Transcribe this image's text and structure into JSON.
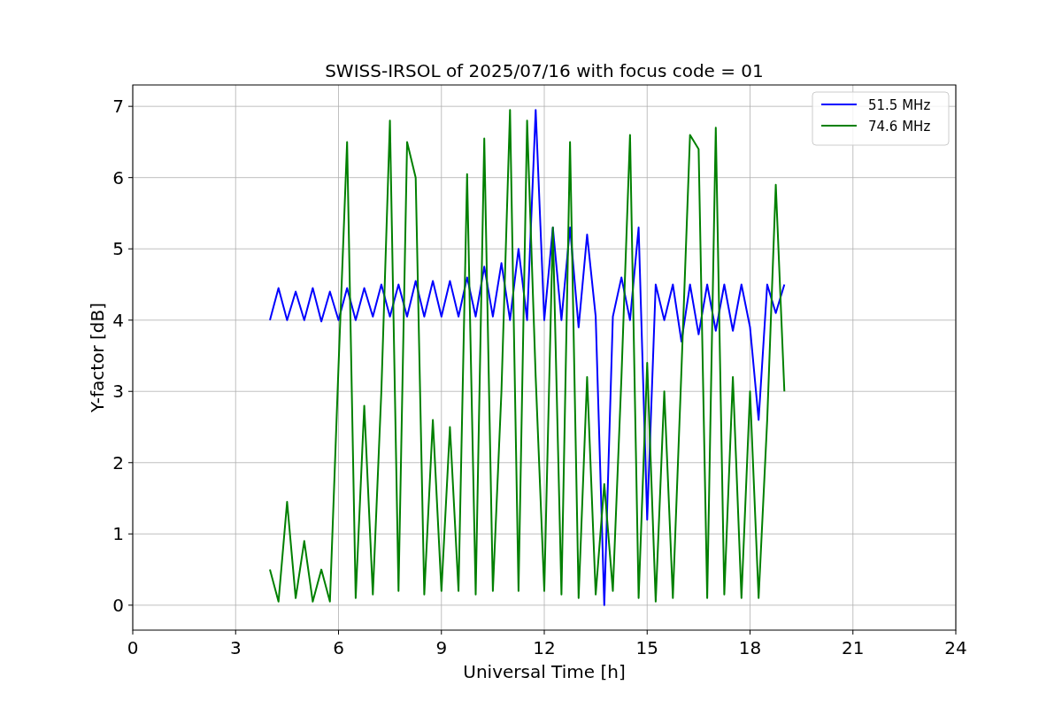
{
  "figure": {
    "chart_data": {
      "type": "line",
      "title": "SWISS-IRSOL of 2025/07/16 with focus code = 01",
      "xlabel": "Universal Time [h]",
      "ylabel": "Y-factor [dB]",
      "x": [
        4,
        4.25,
        4.5,
        4.75,
        5,
        5.25,
        5.5,
        5.75,
        6,
        6.25,
        6.5,
        6.75,
        7,
        7.25,
        7.5,
        7.75,
        8,
        8.25,
        8.5,
        8.75,
        9,
        9.25,
        9.5,
        9.75,
        10,
        10.25,
        10.5,
        10.75,
        11,
        11.25,
        11.5,
        11.75,
        12,
        12.25,
        12.5,
        12.75,
        13,
        13.25,
        13.5,
        13.75,
        14,
        14.25,
        14.5,
        14.75,
        15,
        15.25,
        15.5,
        15.75,
        16,
        16.25,
        16.5,
        16.75,
        17,
        17.25,
        17.5,
        17.75,
        18,
        18.25,
        18.5,
        18.75,
        19
      ],
      "series": [
        {
          "name": "51.5 MHz",
          "color": "#0000ff",
          "values": [
            4.0,
            4.45,
            4.0,
            4.4,
            4.0,
            4.45,
            3.98,
            4.4,
            4.0,
            4.45,
            4.0,
            4.45,
            4.05,
            4.5,
            4.05,
            4.5,
            4.05,
            4.55,
            4.05,
            4.55,
            4.05,
            4.55,
            4.05,
            4.6,
            4.05,
            4.75,
            4.05,
            4.8,
            4.0,
            5.0,
            4.0,
            6.95,
            4.0,
            5.3,
            4.0,
            5.3,
            3.9,
            5.2,
            4.05,
            0.0,
            4.05,
            4.6,
            4.0,
            5.3,
            1.2,
            4.5,
            4.0,
            4.5,
            3.7,
            4.5,
            3.8,
            4.5,
            3.85,
            4.5,
            3.85,
            4.5,
            3.9,
            2.6,
            4.5,
            4.1,
            4.5
          ]
        },
        {
          "name": "74.6 MHz",
          "color": "#008000",
          "values": [
            0.5,
            0.05,
            1.45,
            0.1,
            0.9,
            0.05,
            0.5,
            0.05,
            3.35,
            6.5,
            0.1,
            2.8,
            0.15,
            3.0,
            6.8,
            0.2,
            6.5,
            6.0,
            0.15,
            2.6,
            0.2,
            2.5,
            0.2,
            6.05,
            0.15,
            6.55,
            0.2,
            3.0,
            6.95,
            0.2,
            6.8,
            3.2,
            0.2,
            5.3,
            0.15,
            6.5,
            0.1,
            3.2,
            0.15,
            1.7,
            0.2,
            3.2,
            6.6,
            0.1,
            3.4,
            0.05,
            3.0,
            0.1,
            3.3,
            6.6,
            6.4,
            0.1,
            6.7,
            0.15,
            3.2,
            0.1,
            3.0,
            0.1,
            2.6,
            5.9,
            3.0
          ]
        }
      ],
      "grid": true,
      "legend": true,
      "xlim": [
        0,
        24
      ],
      "ylim": [
        -0.35,
        7.3
      ],
      "xticks": [
        0,
        3,
        6,
        9,
        12,
        15,
        18,
        21,
        24
      ],
      "yticks": [
        0,
        1,
        2,
        3,
        4,
        5,
        6,
        7
      ]
    }
  }
}
